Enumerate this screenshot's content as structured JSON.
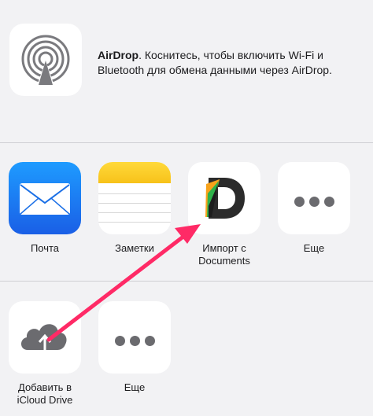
{
  "airdrop": {
    "title": "AirDrop",
    "description": ". Коснитесь, чтобы включить Wi-Fi и Bluetooth для обмена данными через AirDrop."
  },
  "apps": [
    {
      "label": "Почта",
      "icon": "mail-icon"
    },
    {
      "label": "Заметки",
      "icon": "notes-icon"
    },
    {
      "label_line1": "Импорт с",
      "label_line2": "Documents",
      "icon": "documents-icon"
    },
    {
      "label": "Еще",
      "icon": "more-icon"
    }
  ],
  "actions": [
    {
      "label_line1": "Добавить в",
      "label_line2": "iCloud Drive",
      "icon": "icloud-upload-icon"
    },
    {
      "label": "Еще",
      "icon": "more-icon"
    }
  ],
  "colors": {
    "background": "#f2f2f4",
    "arrow": "#ff2a66",
    "mail": "#1a7cff",
    "notes_yellow": "#f7c21a",
    "icon_gray": "#6b6b6f"
  }
}
